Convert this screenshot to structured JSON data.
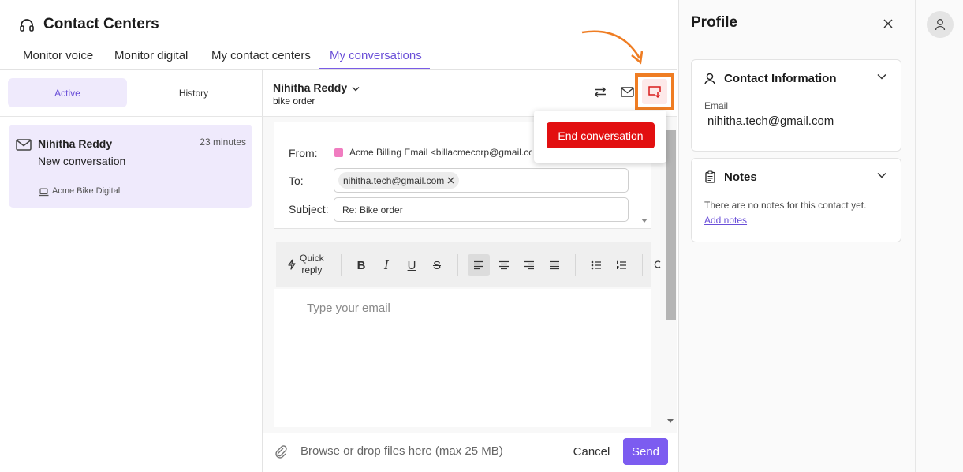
{
  "app": {
    "title": "Contact Centers"
  },
  "tabs": [
    {
      "label": "Monitor voice"
    },
    {
      "label": "Monitor digital"
    },
    {
      "label": "My contact centers"
    },
    {
      "label": "My conversations"
    }
  ],
  "left": {
    "segments": {
      "active": "Active",
      "history": "History"
    },
    "conversation": {
      "name": "Nihitha Reddy",
      "time": "23 minutes",
      "status": "New conversation",
      "channel": "Acme Bike Digital"
    }
  },
  "conversation_header": {
    "name": "Nihitha Reddy",
    "subject": "bike order"
  },
  "email": {
    "from_label": "From:",
    "from_value": "Acme Billing Email <billacmecorp@gmail.com>",
    "to_label": "To:",
    "to_value": "nihitha.tech@gmail.com",
    "subject_label": "Subject:",
    "subject_value": "Re: Bike order",
    "body_placeholder": "Type your email"
  },
  "toolbar": {
    "quick_reply_line1": "Quick",
    "quick_reply_line2": "reply",
    "bold": "B",
    "italic": "I",
    "underline": "U",
    "strike": "S"
  },
  "bottom": {
    "attach_text": "Browse or drop files here (max 25 MB)",
    "cancel": "Cancel",
    "send": "Send"
  },
  "popover": {
    "end_conversation": "End conversation"
  },
  "profile": {
    "title": "Profile",
    "contact_title": "Contact Information",
    "email_label": "Email",
    "email_value": "nihitha.tech@gmail.com",
    "notes_title": "Notes",
    "notes_empty": "There are no notes for this contact yet.",
    "add_notes": "Add notes"
  },
  "colors": {
    "accent": "#7c5cf0",
    "danger": "#e20f10",
    "highlight": "#ef7d23",
    "from_swatch": "#f07cc0"
  }
}
